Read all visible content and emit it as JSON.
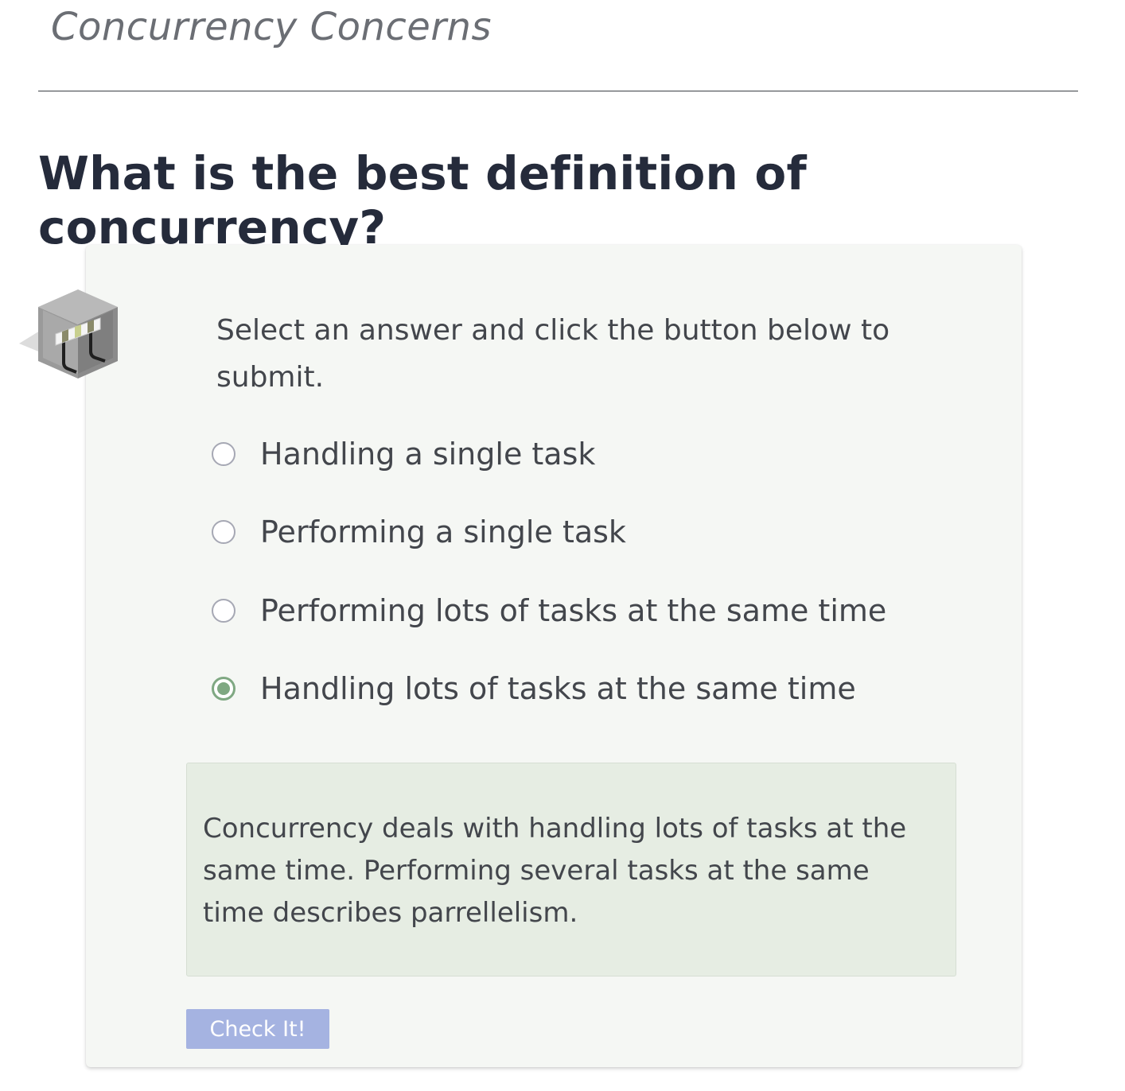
{
  "page": {
    "section_title": "Concurrency Concerns",
    "question": "What is the best definition of concurrency?"
  },
  "card": {
    "icon": "hurdle-barrier-icon",
    "instructions": "Select an answer and click the button below to submit.",
    "options": [
      {
        "label": "Handling a single task",
        "selected": false
      },
      {
        "label": "Performing a single task",
        "selected": false
      },
      {
        "label": "Performing lots of tasks at the same time",
        "selected": false
      },
      {
        "label": "Handling lots of tasks at the same time",
        "selected": true
      }
    ],
    "feedback": "Concurrency deals with handling lots of tasks at the same time. Performing several tasks at the same time describes parrellelism.",
    "check_button_label": "Check It!"
  },
  "colors": {
    "heading": "#252b3b",
    "selected_radio": "#7fa882",
    "feedback_background": "#e6ede3",
    "button_background": "#a5b3e1"
  }
}
